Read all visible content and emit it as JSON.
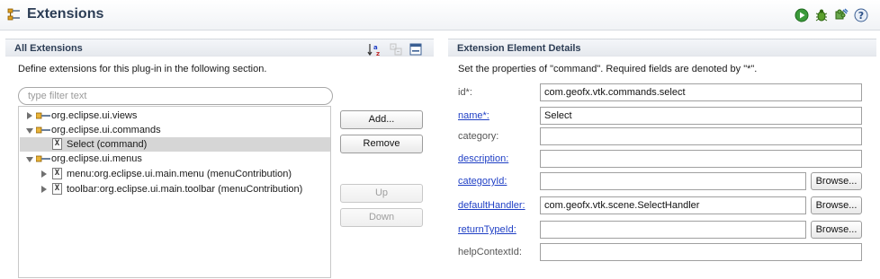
{
  "header": {
    "title": "Extensions",
    "tools": [
      "run-icon",
      "debug-icon",
      "puzzle-icon",
      "help-icon"
    ]
  },
  "left": {
    "section_title": "All Extensions",
    "description": "Define extensions for this plug-in in the following section.",
    "filter_placeholder": "type filter text",
    "toolbar_icons": [
      "sort-alpha-icon",
      "collapse-disabled-icon",
      "minimize-icon"
    ],
    "tree": [
      {
        "label": "org.eclipse.ui.views",
        "state": "closed",
        "kind": "extension",
        "indent": 0
      },
      {
        "label": "org.eclipse.ui.commands",
        "state": "open",
        "kind": "extension",
        "indent": 0
      },
      {
        "label": "Select (command)",
        "state": "none",
        "kind": "element",
        "indent": 1,
        "selected": true
      },
      {
        "label": "org.eclipse.ui.menus",
        "state": "open",
        "kind": "extension",
        "indent": 0
      },
      {
        "label": "menu:org.eclipse.ui.main.menu (menuContribution)",
        "state": "closed",
        "kind": "element",
        "indent": 1
      },
      {
        "label": "toolbar:org.eclipse.ui.main.toolbar (menuContribution)",
        "state": "closed",
        "kind": "element",
        "indent": 1
      }
    ],
    "buttons": {
      "add": "Add...",
      "remove": "Remove",
      "up": "Up",
      "down": "Down"
    }
  },
  "right": {
    "section_title": "Extension Element Details",
    "description": "Set the properties of \"command\". Required fields are denoted by \"*\".",
    "fields": [
      {
        "label": "id*:",
        "value": "com.geofx.vtk.commands.select",
        "link": false,
        "browse": false
      },
      {
        "label": "name*:",
        "value": "Select",
        "link": true,
        "browse": false
      },
      {
        "label": "category:",
        "value": "",
        "link": false,
        "browse": false
      },
      {
        "label": "description:",
        "value": "",
        "link": true,
        "browse": false
      },
      {
        "label": "categoryId:",
        "value": "",
        "link": true,
        "browse": true
      },
      {
        "label": "defaultHandler:",
        "value": "com.geofx.vtk.scene.SelectHandler",
        "link": true,
        "browse": true
      },
      {
        "label": "returnTypeId:",
        "value": "",
        "link": true,
        "browse": true
      },
      {
        "label": "helpContextId:",
        "value": "",
        "link": false,
        "browse": false
      }
    ],
    "browse_label": "Browse..."
  },
  "colors": {
    "title": "#2c3d55",
    "link": "#1f3fc5",
    "selection": "#d6d6d6"
  }
}
